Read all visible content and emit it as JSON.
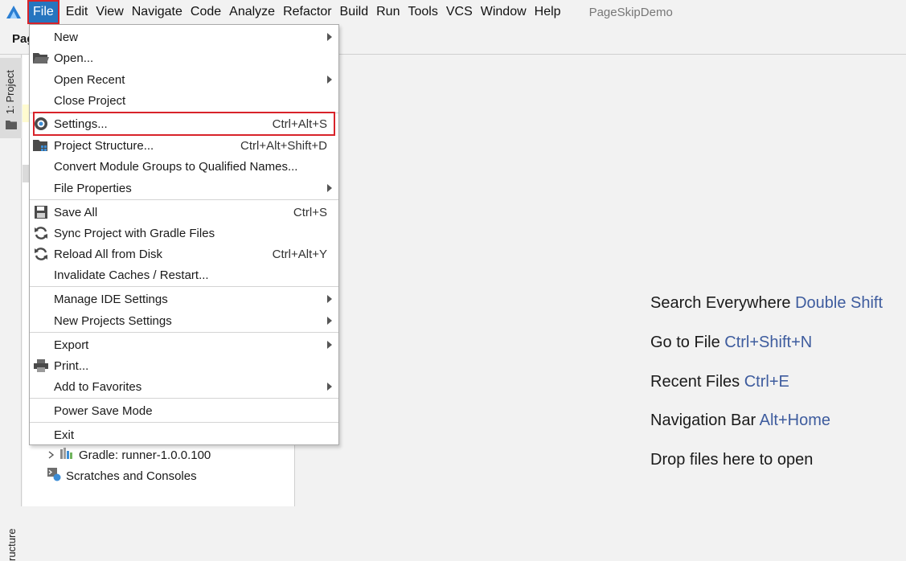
{
  "menubar": {
    "items": [
      {
        "label": "File",
        "active": true
      },
      {
        "label": "Edit"
      },
      {
        "label": "View"
      },
      {
        "label": "Navigate"
      },
      {
        "label": "Code"
      },
      {
        "label": "Analyze"
      },
      {
        "label": "Refactor"
      },
      {
        "label": "Build"
      },
      {
        "label": "Run"
      },
      {
        "label": "Tools"
      },
      {
        "label": "VCS"
      },
      {
        "label": "Window"
      },
      {
        "label": "Help"
      }
    ],
    "project_title": "PageSkipDemo"
  },
  "toolbar": {
    "title_fragment": "Pag"
  },
  "left_strip": {
    "project_tab": "1: Project",
    "bottom_tab": "ructure"
  },
  "project_tree": {
    "gradle_item": "Gradle: runner-1.0.0.100",
    "scratches_item": "Scratches and Consoles"
  },
  "file_menu": {
    "new": "New",
    "open": "Open...",
    "open_recent": "Open Recent",
    "close_project": "Close Project",
    "settings": "Settings...",
    "settings_shortcut": "Ctrl+Alt+S",
    "project_structure": "Project Structure...",
    "project_structure_shortcut": "Ctrl+Alt+Shift+D",
    "convert_module": "Convert Module Groups to Qualified Names...",
    "file_properties": "File Properties",
    "save_all": "Save All",
    "save_all_shortcut": "Ctrl+S",
    "sync_gradle": "Sync Project with Gradle Files",
    "reload_disk": "Reload All from Disk",
    "reload_disk_shortcut": "Ctrl+Alt+Y",
    "invalidate_caches": "Invalidate Caches / Restart...",
    "manage_ide": "Manage IDE Settings",
    "new_projects_settings": "New Projects Settings",
    "export": "Export",
    "print": "Print...",
    "add_favorites": "Add to Favorites",
    "power_save": "Power Save Mode",
    "exit": "Exit"
  },
  "editor_hints": {
    "search_label": "Search Everywhere",
    "search_key": "Double Shift",
    "gotofile_label": "Go to File",
    "gotofile_key": "Ctrl+Shift+N",
    "recent_label": "Recent Files",
    "recent_key": "Ctrl+E",
    "navbar_label": "Navigation Bar",
    "navbar_key": "Alt+Home",
    "drop_label": "Drop files here to open"
  },
  "colors": {
    "accent": "#2675bf",
    "highlight_box": "#d8232a",
    "shortcut_text": "#3e5c9e"
  }
}
